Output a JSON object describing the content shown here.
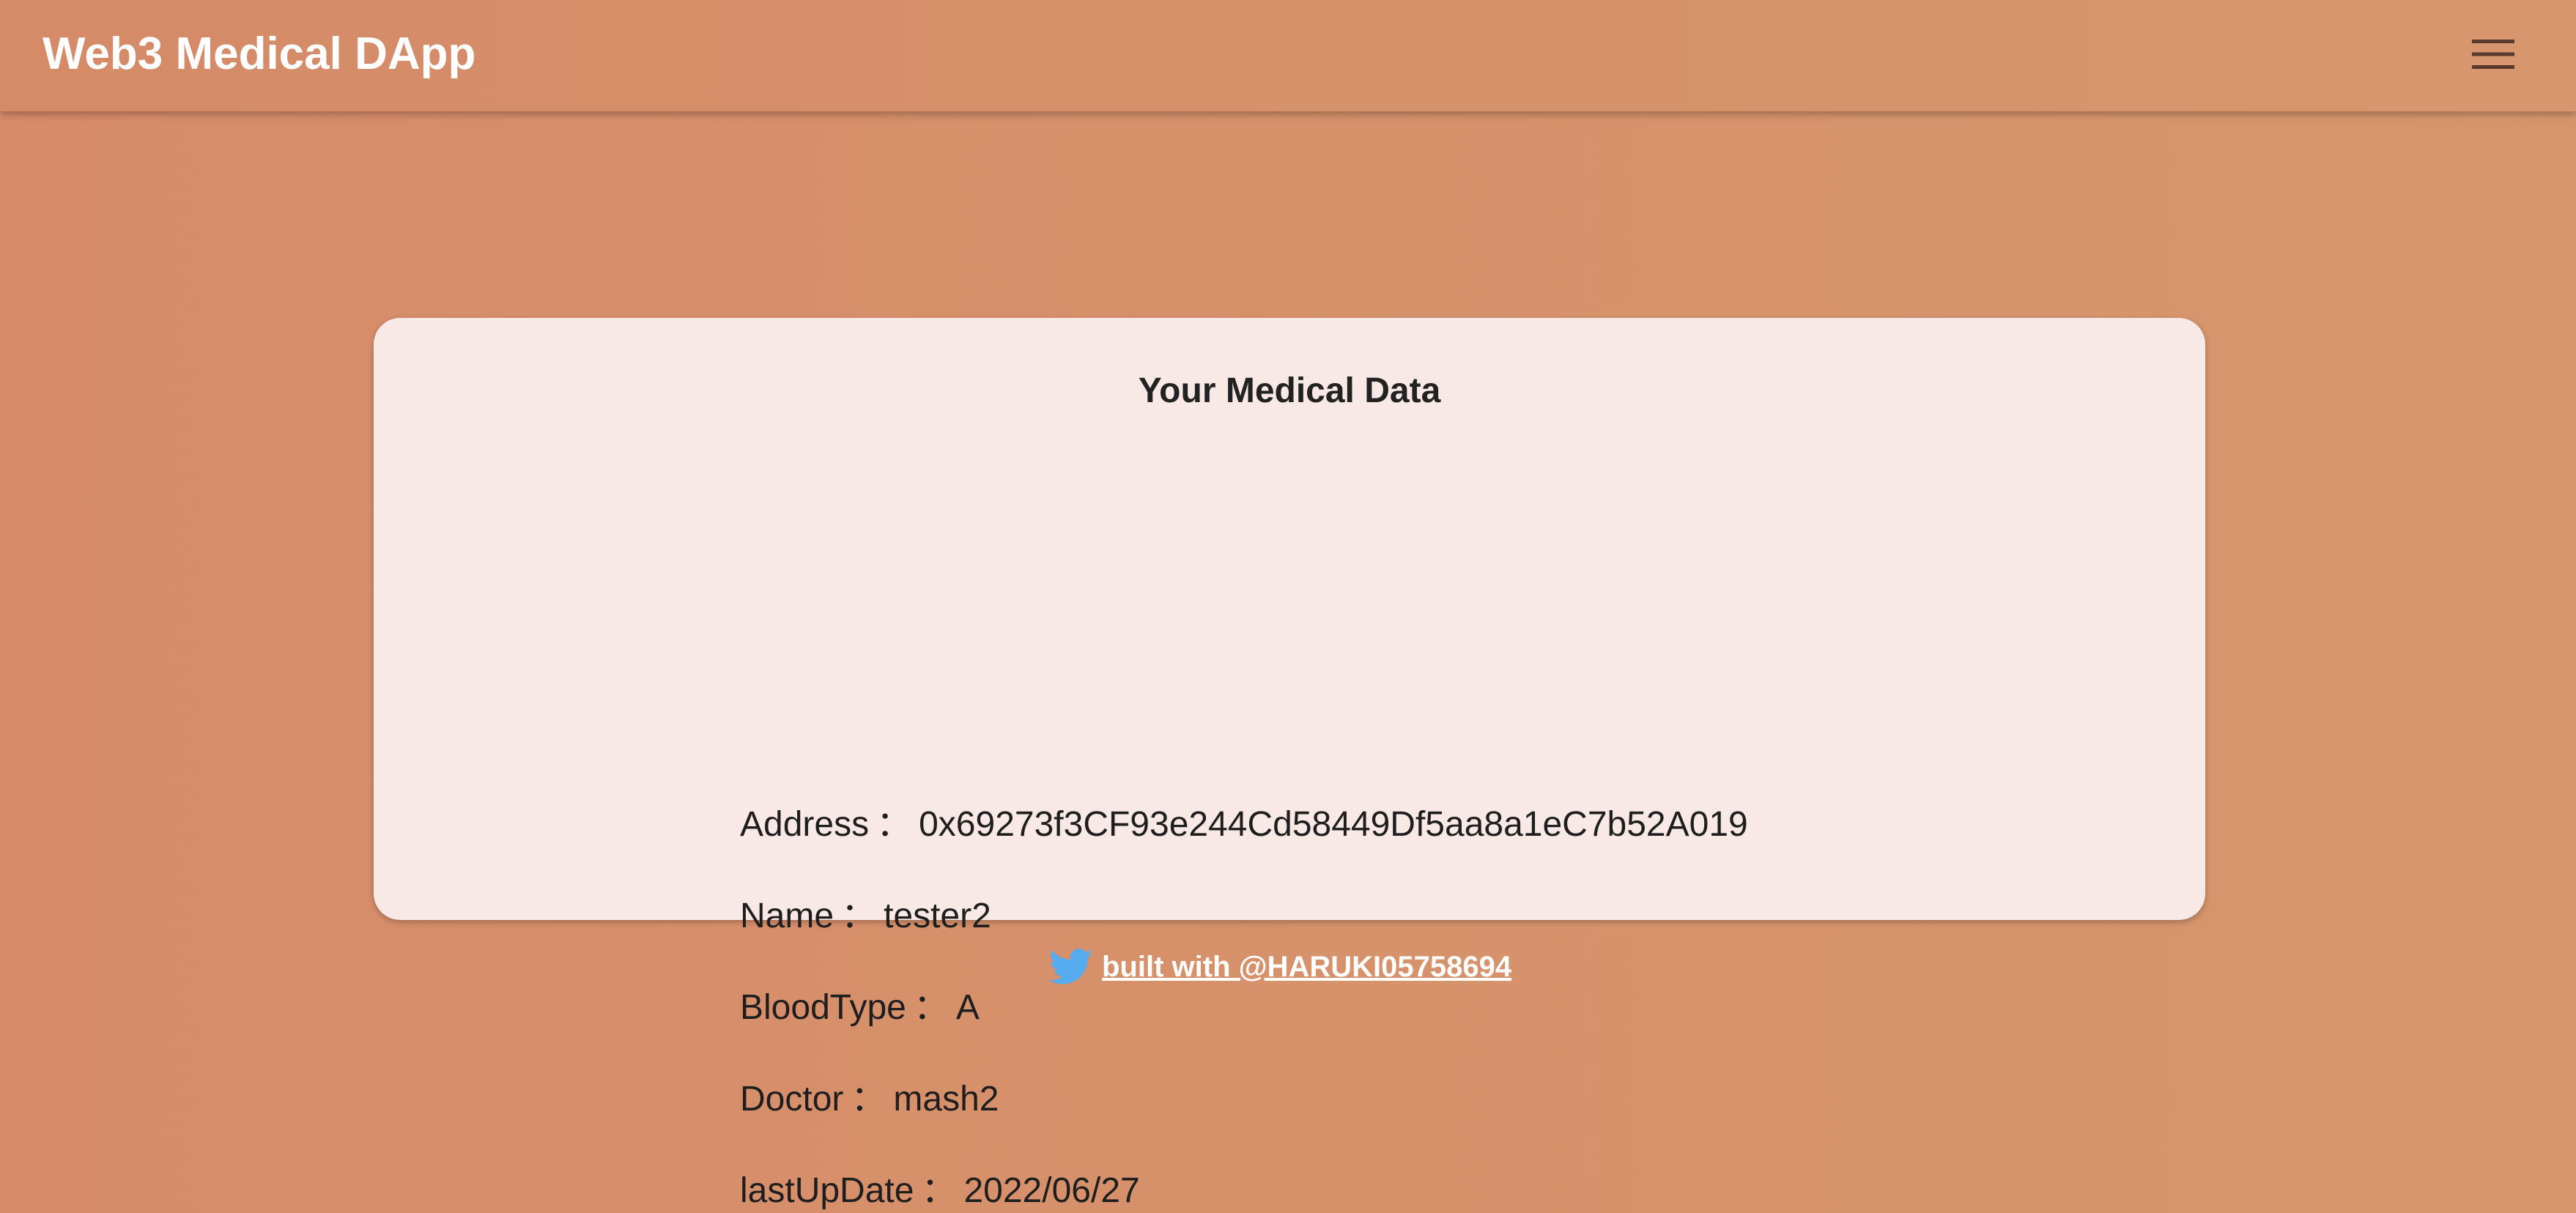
{
  "header": {
    "app_title": "Web3 Medical DApp",
    "menu_icon": "hamburger-menu-icon"
  },
  "card": {
    "title": "Your Medical Data",
    "separator": "：",
    "fields": [
      {
        "label": "Address",
        "value": "0x69273f3CF93e244Cd58449Df5aa8a1eC7b52A019"
      },
      {
        "label": "Name",
        "value": "tester2"
      },
      {
        "label": "BloodType",
        "value": "A"
      },
      {
        "label": "Doctor",
        "value": "mash2"
      },
      {
        "label": "lastUpDate",
        "value": "2022/06/27"
      }
    ]
  },
  "footer": {
    "icon": "twitter-bird-icon",
    "link_text": "built with @HARUKI05758694",
    "icon_color": "#55acee"
  },
  "colors": {
    "background": "#d6906b",
    "card_background": "#f8e9e6",
    "header_text": "#ffffff",
    "body_text": "#1e1e1e"
  }
}
